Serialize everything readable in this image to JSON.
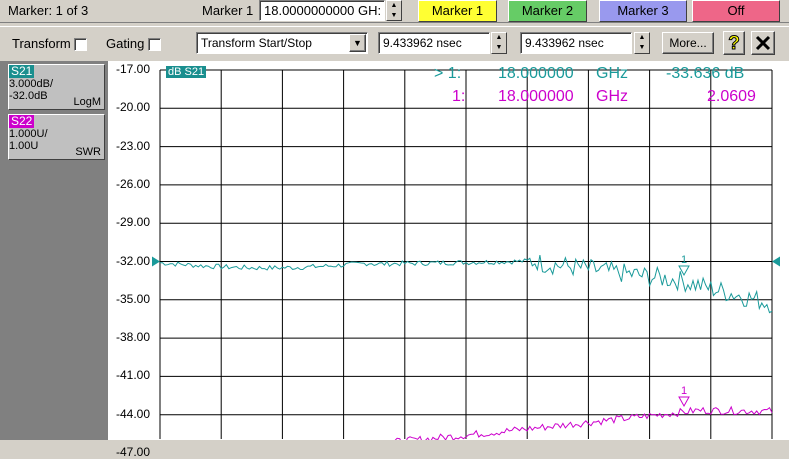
{
  "marker_status": "Marker: 1 of 3",
  "marker_label": "Marker 1",
  "marker_value": "18.0000000000 GH:",
  "marker_buttons": [
    {
      "label": "Marker 1",
      "color": "#ffff33"
    },
    {
      "label": "Marker 2",
      "color": "#66cc66"
    },
    {
      "label": "Marker 3",
      "color": "#9999ee"
    },
    {
      "label": "Off",
      "color": "#ee6688"
    }
  ],
  "toolbar": {
    "transform_label": "Transform",
    "gating_label": "Gating",
    "mode_select": "Transform Start/Stop",
    "start_value": "9.433962 nsec",
    "stop_value": "9.433962 nsec",
    "more_label": "More...",
    "help_icon": "question-mark-icon",
    "close_icon": "close-icon"
  },
  "traces": [
    {
      "name": "S21",
      "line1": "3.000dB/",
      "line2": "-32.0dB",
      "format": "LogM",
      "color": "#1a8f8f"
    },
    {
      "name": "S22",
      "line1": "1.000U/",
      "line2": "1.00U",
      "format": "SWR",
      "color": "#cc00cc"
    }
  ],
  "plot": {
    "trace_tag": "dB S21",
    "y_labels": [
      "-17.00",
      "-20.00",
      "-23.00",
      "-26.00",
      "-29.00",
      "-32.00",
      "-35.00",
      "-38.00",
      "-41.00",
      "-44.00",
      "-47.00"
    ],
    "readouts": [
      {
        "prefix": "> 1:",
        "freq": "18.000000",
        "unit": "GHz",
        "value": "-33.636 dB",
        "color": "#1a9a9a"
      },
      {
        "prefix": "1:",
        "freq": "18.000000",
        "unit": "GHz",
        "value": "2.0609",
        "color": "#cc00cc"
      }
    ],
    "marker_number": "1"
  },
  "colors": {
    "s21": "#1a9a9a",
    "s22": "#cc00cc",
    "grid": "#000000"
  }
}
